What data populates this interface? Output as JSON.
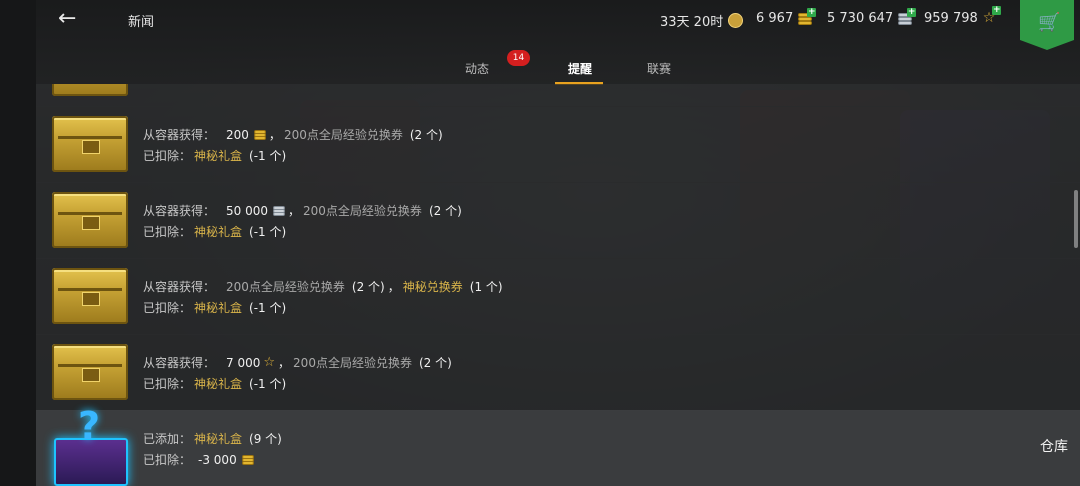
{
  "header": {
    "title": "新闻",
    "premium": "33天 20时",
    "gold": "6 967",
    "silver": "5 730 647",
    "free_xp": "959 798"
  },
  "tabs": [
    {
      "label": "动态",
      "badge": "14"
    },
    {
      "label": "提醒",
      "active": true
    },
    {
      "label": "联赛"
    }
  ],
  "labels": {
    "obtained": "从容器获得：",
    "deducted": "已扣除：",
    "added": "已添加："
  },
  "rows": [
    {
      "obtained": [
        {
          "value": "200",
          "icon": "gold-icon"
        },
        {
          "sep": "，"
        },
        {
          "item": "200点全局经验兑换券",
          "qty": "(2 个)"
        }
      ],
      "deducted": {
        "item": "神秘礼盒",
        "qty": "(-1 个)"
      }
    },
    {
      "obtained": [
        {
          "value": "50 000",
          "icon": "silver-icon"
        },
        {
          "sep": "，"
        },
        {
          "item": "200点全局经验兑换券",
          "qty": "(2 个)"
        }
      ],
      "deducted": {
        "item": "神秘礼盒",
        "qty": "(-1 个)"
      }
    },
    {
      "obtained": [
        {
          "item": "200点全局经验兑换券",
          "qty": "(2 个)"
        },
        {
          "sep": "，"
        },
        {
          "item": "神秘兑换券",
          "qty": "(1 个)"
        }
      ],
      "deducted": {
        "item": "神秘礼盒",
        "qty": "(-1 个)"
      }
    },
    {
      "obtained": [
        {
          "value": "7 000",
          "icon": "star-icon"
        },
        {
          "sep": "，"
        },
        {
          "item": "200点全局经验兑换券",
          "qty": "(2 个)"
        }
      ],
      "deducted": {
        "item": "神秘礼盒",
        "qty": "(-1 个)"
      }
    },
    {
      "added": {
        "item": "神秘礼盒",
        "qty": "(9 个)"
      },
      "deducted": {
        "value": "-3 000",
        "icon": "gold-icon"
      }
    }
  ],
  "warehouse_label": "仓库",
  "colors": {
    "accent": "#e8a21f",
    "gold_text": "#d9b44a",
    "badge": "#d41f1f",
    "shop": "#2f9a45"
  }
}
